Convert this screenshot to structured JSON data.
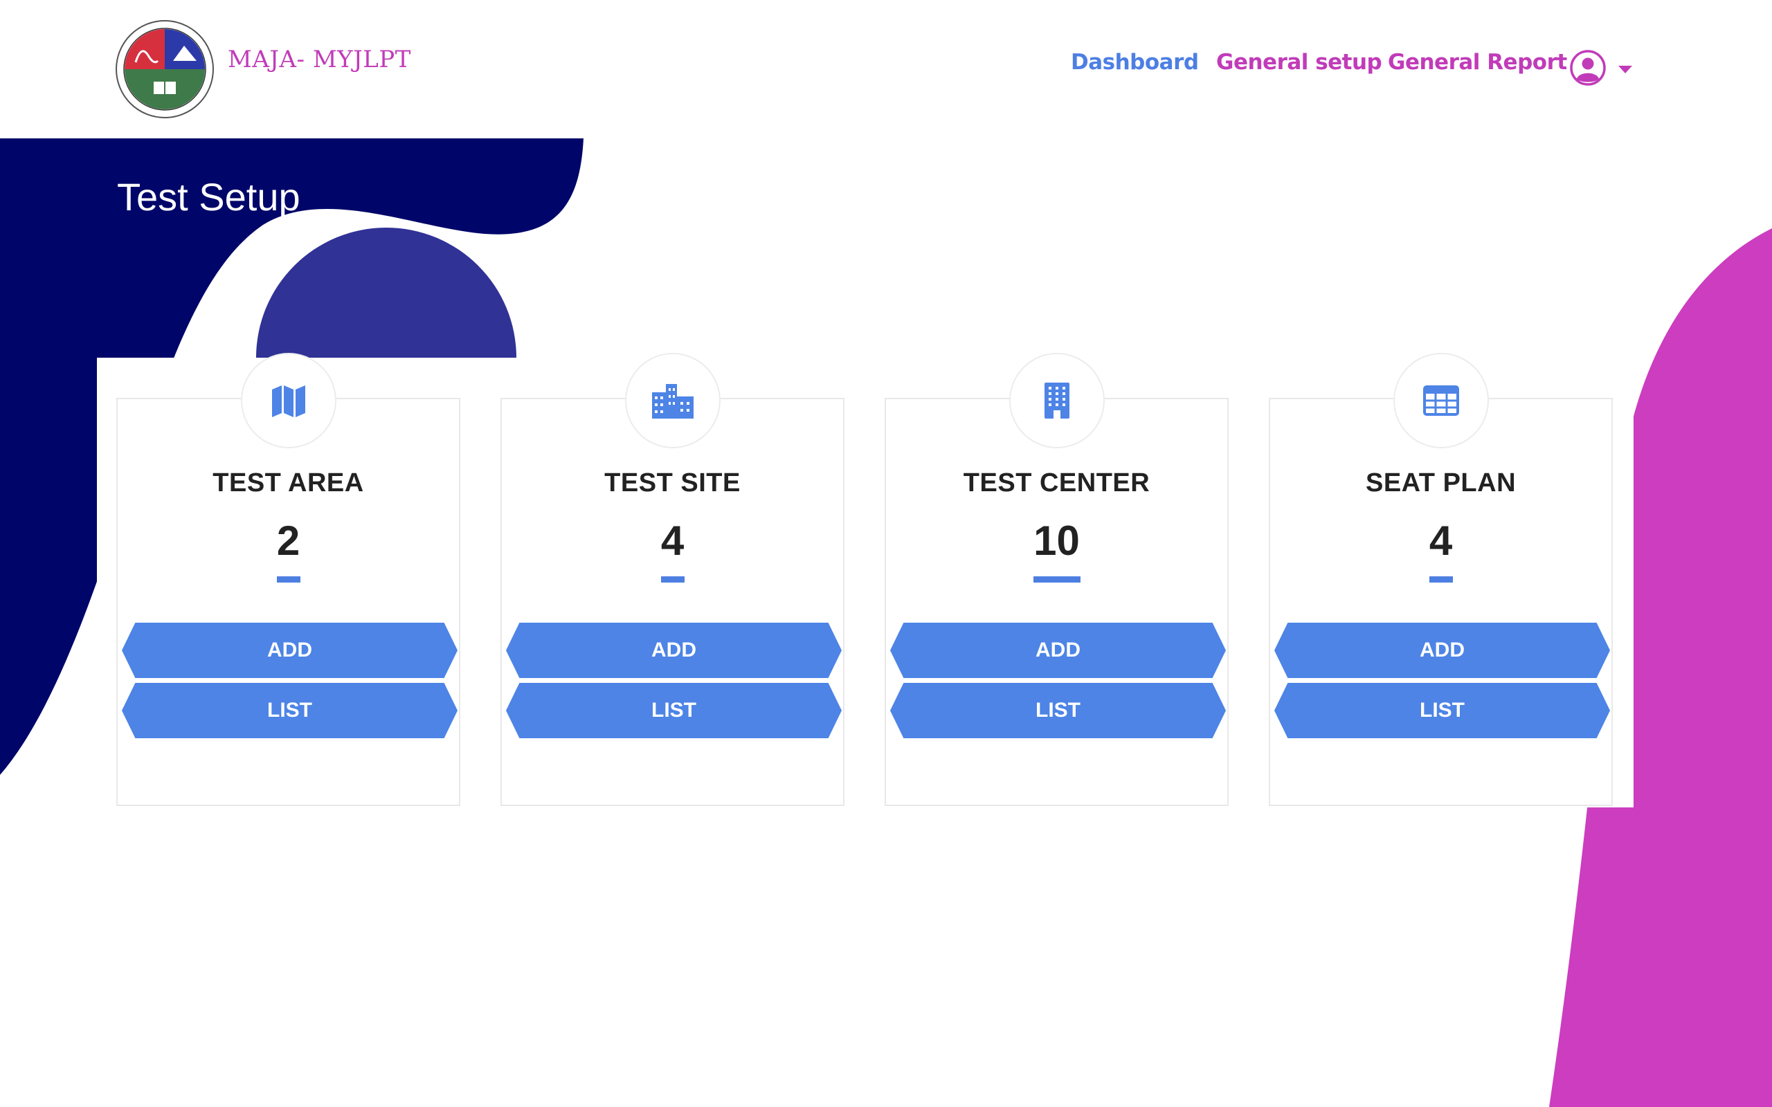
{
  "header": {
    "brand": "MAJA- MYJLPT",
    "nav": {
      "dashboard": "Dashboard",
      "general_setup": "General setup",
      "general_report": "General Report"
    }
  },
  "page": {
    "title": "Test Setup"
  },
  "cards": [
    {
      "title": "TEST AREA",
      "count": "2",
      "icon": "map-icon",
      "add_label": "ADD",
      "list_label": "LIST"
    },
    {
      "title": "TEST SITE",
      "count": "4",
      "icon": "building-complex-icon",
      "add_label": "ADD",
      "list_label": "LIST"
    },
    {
      "title": "TEST CENTER",
      "count": "10",
      "icon": "building-icon",
      "add_label": "ADD",
      "list_label": "LIST"
    },
    {
      "title": "SEAT PLAN",
      "count": "4",
      "icon": "table-grid-icon",
      "add_label": "ADD",
      "list_label": "LIST"
    }
  ],
  "colors": {
    "primary_blue": "#4d84e6",
    "navy": "#000669",
    "indigo": "#303296",
    "magenta": "#cc3dbf",
    "brand_text": "#c13bb9"
  }
}
